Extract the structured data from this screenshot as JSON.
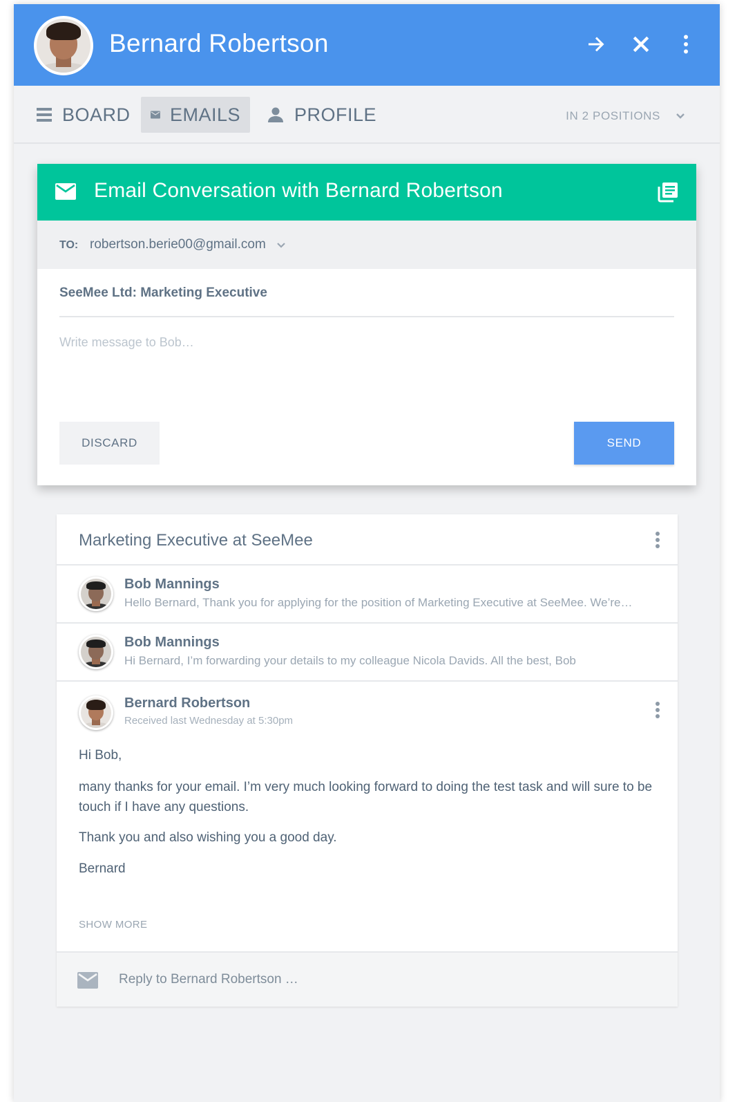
{
  "header": {
    "name": "Bernard Robertson",
    "icons": [
      "arrow-right-icon",
      "close-icon",
      "more-vertical-icon"
    ]
  },
  "tabs": [
    {
      "label": "BOARD",
      "icon": "list-icon",
      "active": false
    },
    {
      "label": "EMAILS",
      "icon": "mail-icon",
      "active": true
    },
    {
      "label": "PROFILE",
      "icon": "person-icon",
      "active": false
    }
  ],
  "positions_label": "IN 2 POSITIONS",
  "compose": {
    "title": "Email Conversation with Bernard Robertson",
    "to_label": "TO:",
    "to_value": "robertson.berie00@gmail.com",
    "subject": "SeeMee Ltd: Marketing Executive",
    "placeholder": "Write message to Bob…",
    "discard_label": "DISCARD",
    "send_label": "SEND"
  },
  "conversation": {
    "title": "Marketing Executive at SeeMee",
    "messages": [
      {
        "sender": "Bob Mannings",
        "snippet": "Hello Bernard, Thank you for applying for the position of Marketing Executive at SeeMee. We’re…"
      },
      {
        "sender": "Bob Mannings",
        "snippet": "Hi Bernard, I’m forwarding your details to my colleague Nicola Davids. All the best, Bob"
      }
    ],
    "expanded": {
      "sender": "Bernard Robertson",
      "meta": "Received last Wednesday at 5:30pm",
      "greeting": "Hi Bob,",
      "paragraph1": "many thanks for your email. I’m very much looking forward to doing the test task and will sure to be touch if I have any questions.",
      "paragraph2": "Thank you and also wishing you a good day.",
      "signature": "Bernard"
    },
    "show_more_label": "SHOW MORE",
    "reply_placeholder": "Reply to Bernard Robertson …"
  },
  "colors": {
    "header": "#4a93ec",
    "compose_header": "#00c59b",
    "send_button": "#5a9af0",
    "background": "#f1f2f4"
  }
}
